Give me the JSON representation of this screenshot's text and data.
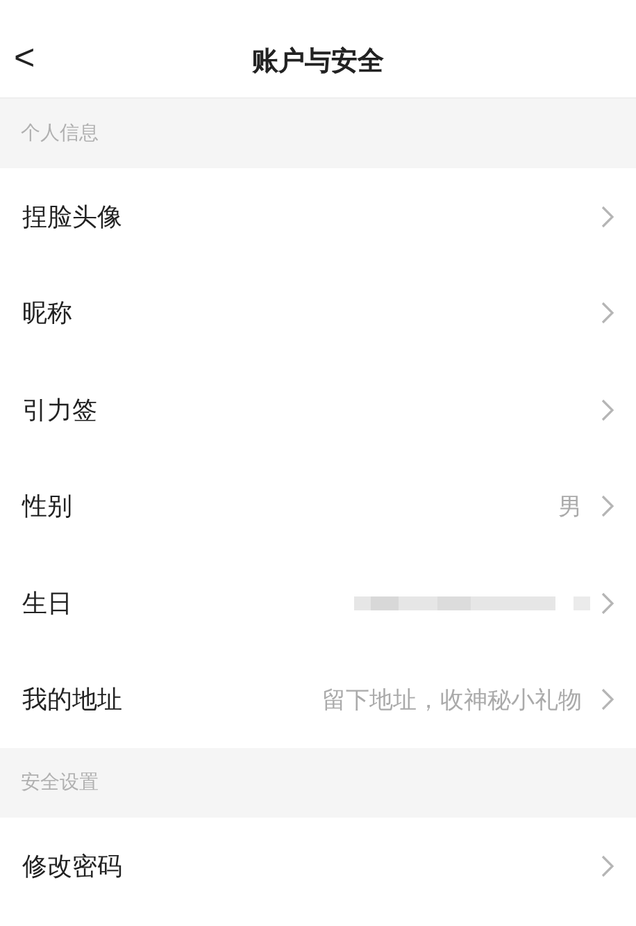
{
  "nav": {
    "back": "<",
    "title": "账户与安全"
  },
  "sections": [
    {
      "title": "个人信息",
      "rows": [
        {
          "kind": "plain",
          "label": "捏脸头像"
        },
        {
          "kind": "plain",
          "label": "昵称"
        },
        {
          "kind": "plain",
          "label": "引力签"
        },
        {
          "kind": "value",
          "label": "性别",
          "value": "男"
        },
        {
          "kind": "blurred",
          "label": "生日"
        },
        {
          "kind": "value",
          "label": "我的地址",
          "value": "留下地址，收神秘小礼物"
        }
      ]
    },
    {
      "title": "安全设置",
      "rows": [
        {
          "kind": "plain",
          "label": "修改密码"
        }
      ]
    }
  ]
}
